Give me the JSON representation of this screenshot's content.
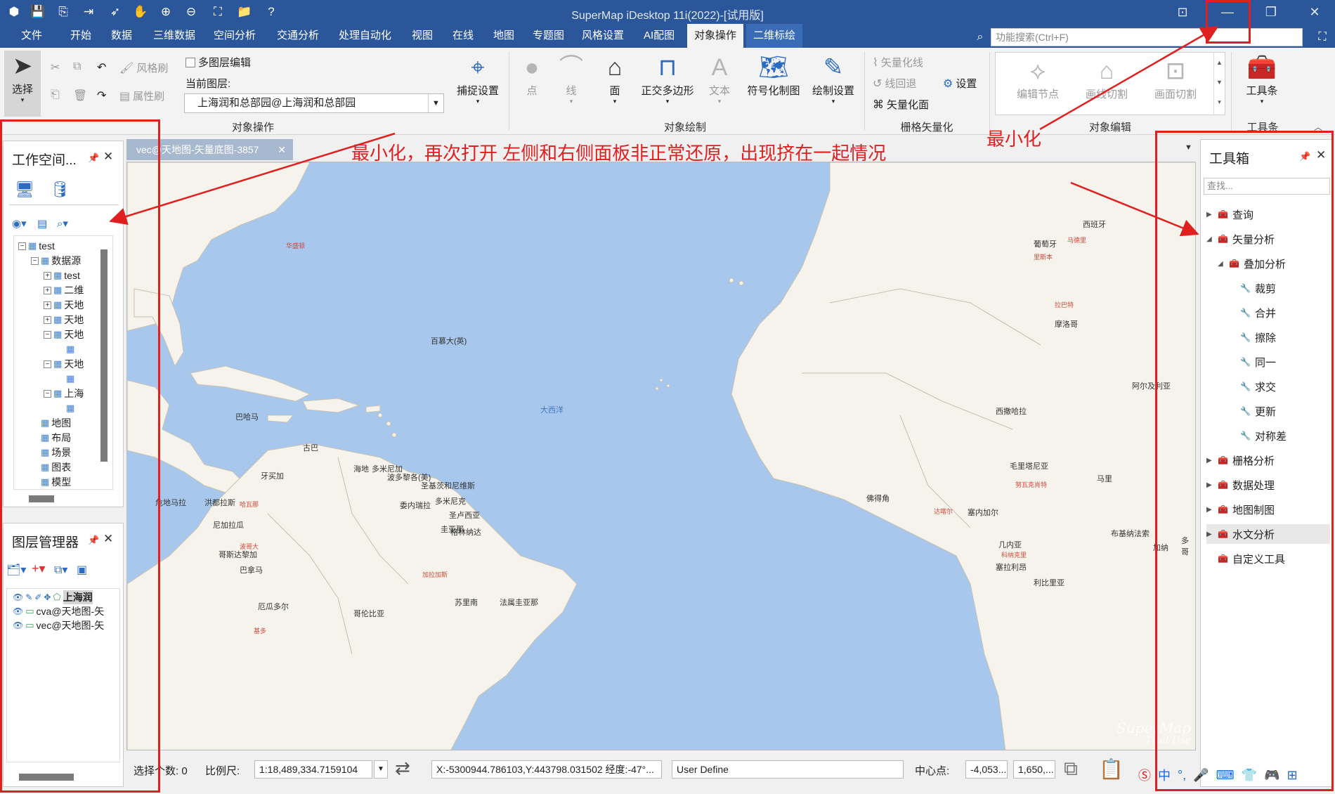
{
  "titlebar": {
    "title": "SuperMap iDesktop 11i(2022)-[试用版]",
    "minimize": "—",
    "restore": "❐",
    "close": "✕"
  },
  "menu": {
    "tabs": [
      "文件",
      "开始",
      "数据",
      "三维数据",
      "空间分析",
      "交通分析",
      "处理自动化",
      "视图",
      "在线",
      "地图",
      "专题图",
      "风格设置",
      "AI配图",
      "对象操作",
      "二维标绘"
    ],
    "active": "对象操作",
    "search_placeholder": "功能搜索(Ctrl+F)"
  },
  "ribbon": {
    "select": "选择",
    "style_brush": "风格刷",
    "attr_brush": "属性刷",
    "multi_layer_edit": "多图层编辑",
    "current_layer_label": "当前图层:",
    "current_layer": "上海润和总部园@上海润和总部园",
    "snap_settings": "捕捉设置",
    "group_object_ops": "对象操作",
    "point": "点",
    "line": "线",
    "face": "面",
    "ortho_polygon": "正交多边形",
    "text": "文本",
    "symbol_draw": "符号化制图",
    "draw_settings": "绘制设置",
    "group_object_draw": "对象绘制",
    "vectorize_line": "矢量化线",
    "line_backtrack": "线回退",
    "vectorize_face": "矢量化面",
    "settings": "设置",
    "group_raster_vectorize": "栅格矢量化",
    "edit_node": "编辑节点",
    "cut_by_line": "画线切割",
    "cut_by_face": "画面切割",
    "group_object_edit": "对象编辑",
    "toolbar": "工具条",
    "group_toolbar": "工具条"
  },
  "workspace": {
    "title": "工作空间...",
    "tree": [
      {
        "label": "test",
        "indent": 0,
        "toggle": "−"
      },
      {
        "label": "数据源",
        "indent": 1,
        "toggle": "−"
      },
      {
        "label": "test",
        "indent": 2,
        "toggle": "+"
      },
      {
        "label": "二维",
        "indent": 2,
        "toggle": "+"
      },
      {
        "label": "天地",
        "indent": 2,
        "toggle": "+"
      },
      {
        "label": "天地",
        "indent": 2,
        "toggle": "+"
      },
      {
        "label": "天地",
        "indent": 2,
        "toggle": "−"
      },
      {
        "label": "",
        "indent": 3,
        "toggle": ""
      },
      {
        "label": "天地",
        "indent": 2,
        "toggle": "−"
      },
      {
        "label": "",
        "indent": 3,
        "toggle": ""
      },
      {
        "label": "上海",
        "indent": 2,
        "toggle": "−"
      },
      {
        "label": "",
        "indent": 3,
        "toggle": ""
      },
      {
        "label": "地图",
        "indent": 1,
        "toggle": ""
      },
      {
        "label": "布局",
        "indent": 1,
        "toggle": ""
      },
      {
        "label": "场景",
        "indent": 1,
        "toggle": ""
      },
      {
        "label": "图表",
        "indent": 1,
        "toggle": ""
      },
      {
        "label": "模型",
        "indent": 1,
        "toggle": ""
      }
    ]
  },
  "layers": {
    "title": "图层管理器",
    "items": [
      "上海润",
      "cva@天地图-矢",
      "vec@天地图-矢"
    ]
  },
  "document": {
    "tab": "vec@天地图-矢量底图-3857"
  },
  "map": {
    "labels": [
      {
        "t": "西班牙",
        "c": "dark"
      },
      {
        "t": "葡萄牙",
        "c": "dark"
      },
      {
        "t": "马德里",
        "c": "red"
      },
      {
        "t": "里斯本",
        "c": "red"
      },
      {
        "t": "摩洛哥",
        "c": "dark"
      },
      {
        "t": "拉巴特",
        "c": "red"
      },
      {
        "t": "阿尔及利亚",
        "c": "dark"
      },
      {
        "t": "西撒哈拉",
        "c": "dark"
      },
      {
        "t": "毛里塔尼亚",
        "c": "dark"
      },
      {
        "t": "努瓦克肖特",
        "c": "red"
      },
      {
        "t": "马里",
        "c": "dark"
      },
      {
        "t": "佛得角",
        "c": "dark"
      },
      {
        "t": "塞内加尔",
        "c": "dark"
      },
      {
        "t": "达喀尔",
        "c": "red"
      },
      {
        "t": "几内亚",
        "c": "dark"
      },
      {
        "t": "科纳克里",
        "c": "red"
      },
      {
        "t": "塞拉利昂",
        "c": "dark"
      },
      {
        "t": "利比里亚",
        "c": "dark"
      },
      {
        "t": "布基纳法索",
        "c": "dark"
      },
      {
        "t": "加纳",
        "c": "dark"
      },
      {
        "t": "多哥",
        "c": "dark"
      },
      {
        "t": "百慕大(英)",
        "c": "dark"
      },
      {
        "t": "大西洋",
        "c": "blue"
      },
      {
        "t": "巴哈马",
        "c": "dark"
      },
      {
        "t": "古巴",
        "c": "dark"
      },
      {
        "t": "海地",
        "c": "dark"
      },
      {
        "t": "多米尼加",
        "c": "dark"
      },
      {
        "t": "牙买加",
        "c": "dark"
      },
      {
        "t": "危地马拉",
        "c": "dark"
      },
      {
        "t": "洪都拉斯",
        "c": "dark"
      },
      {
        "t": "尼加拉瓜",
        "c": "dark"
      },
      {
        "t": "哥斯达黎加",
        "c": "dark"
      },
      {
        "t": "巴拿马",
        "c": "dark"
      },
      {
        "t": "哥伦比亚",
        "c": "dark"
      },
      {
        "t": "委内瑞拉",
        "c": "dark"
      },
      {
        "t": "圭亚那",
        "c": "dark"
      },
      {
        "t": "苏里南",
        "c": "dark"
      },
      {
        "t": "法属圭亚那",
        "c": "dark"
      },
      {
        "t": "厄瓜多尔",
        "c": "dark"
      },
      {
        "t": "波多黎各(美)",
        "c": "dark"
      },
      {
        "t": "圣基茨和尼维斯",
        "c": "dark"
      },
      {
        "t": "多米尼克",
        "c": "dark"
      },
      {
        "t": "圣卢西亚",
        "c": "dark"
      },
      {
        "t": "格林纳达",
        "c": "dark"
      },
      {
        "t": "华盛顿",
        "c": "red"
      },
      {
        "t": "哈瓦那",
        "c": "red"
      },
      {
        "t": "加拉加斯",
        "c": "red"
      },
      {
        "t": "波哥大",
        "c": "red"
      },
      {
        "t": "基多",
        "c": "red"
      }
    ],
    "watermark_line1": "SuperMap",
    "watermark_line2": "Trial Use"
  },
  "status": {
    "selected_label": "选择个数: 0",
    "scale_label": "比例尺:",
    "scale_value": "1:18,489,334.7159104",
    "coords": "X:-5300944.786103,Y:443798.031502  经度:-47°...",
    "projection": "User Define",
    "center_label": "中心点:",
    "center_x": "-4,053...",
    "center_y": "1,650,..."
  },
  "toolbox": {
    "title": "工具箱",
    "search_placeholder": "查找...",
    "items": [
      {
        "label": "查询",
        "level": 0,
        "expand": "▶"
      },
      {
        "label": "矢量分析",
        "level": 0,
        "expand": "◢"
      },
      {
        "label": "叠加分析",
        "level": 1,
        "expand": "◢"
      },
      {
        "label": "裁剪",
        "level": 2,
        "expand": ""
      },
      {
        "label": "合并",
        "level": 2,
        "expand": ""
      },
      {
        "label": "擦除",
        "level": 2,
        "expand": ""
      },
      {
        "label": "同一",
        "level": 2,
        "expand": ""
      },
      {
        "label": "求交",
        "level": 2,
        "expand": ""
      },
      {
        "label": "更新",
        "level": 2,
        "expand": ""
      },
      {
        "label": "对称差",
        "level": 2,
        "expand": ""
      },
      {
        "label": "栅格分析",
        "level": 0,
        "expand": "▶"
      },
      {
        "label": "数据处理",
        "level": 0,
        "expand": "▶"
      },
      {
        "label": "地图制图",
        "level": 0,
        "expand": "▶"
      },
      {
        "label": "水文分析",
        "level": 0,
        "expand": "▶",
        "selected": true
      },
      {
        "label": "自定义工具",
        "level": 0,
        "expand": ""
      }
    ]
  },
  "annotations": {
    "main": "最小化，再次打开 左侧和右侧面板非正常还原，出现挤在一起情况",
    "minimize": "最小化"
  },
  "colors": {
    "title_blue": "#2b579a",
    "annotation_red": "#e02020",
    "ocean": "#a7c7ec",
    "land": "#f5f3ec"
  }
}
